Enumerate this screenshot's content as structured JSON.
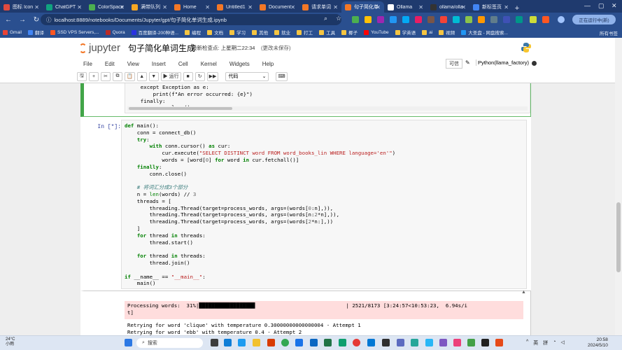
{
  "browser": {
    "tabs": [
      {
        "label": "图标 Icon",
        "color": "#e04a3f"
      },
      {
        "label": "ChatGPT",
        "color": "#10a37f"
      },
      {
        "label": "ColorSpace",
        "color": "#4caf50"
      },
      {
        "label": "满带队列",
        "color": "#f5a623"
      },
      {
        "label": "Home",
        "color": "#f37726"
      },
      {
        "label": "Untitled1",
        "color": "#f37726"
      },
      {
        "label": "Document",
        "color": "#f37726"
      },
      {
        "label": "请求单词",
        "color": "#f37726"
      },
      {
        "label": "句子简化单",
        "color": "#f37726",
        "active": true
      },
      {
        "label": "Ollama",
        "color": "#ffffff"
      },
      {
        "label": "ollama/olla",
        "color": "#333333"
      },
      {
        "label": "新标签页",
        "color": "#4285f4"
      }
    ],
    "new_tab": "+",
    "url": "localhost:8889/notebooks/Documents/Jupyter/gpt/句子简化单词生成.ipynb",
    "profile_label": "正在运行中(新)",
    "bookmarks": [
      {
        "label": "Gmail",
        "color": "#ea4335"
      },
      {
        "label": "翻译",
        "color": "#4285f4"
      },
      {
        "label": "SSD VPS Servers,...",
        "color": "#ff5722"
      },
      {
        "label": "Quora",
        "color": "#b92b27"
      },
      {
        "label": "百度翻译-200种语...",
        "color": "#2932e1"
      },
      {
        "label": "编程",
        "color": "#f5c542"
      },
      {
        "label": "文档",
        "color": "#f5c542"
      },
      {
        "label": "学习",
        "color": "#f5c542"
      },
      {
        "label": "其他",
        "color": "#f5c542"
      },
      {
        "label": "就业",
        "color": "#f5c542"
      },
      {
        "label": "打工",
        "color": "#f5c542"
      },
      {
        "label": "工具",
        "color": "#f5c542"
      },
      {
        "label": "椰子",
        "color": "#f5c542"
      },
      {
        "label": "YouTube",
        "color": "#ff0000"
      },
      {
        "label": "学英语",
        "color": "#f5c542"
      },
      {
        "label": "ai",
        "color": "#f5c542"
      },
      {
        "label": "视频",
        "color": "#f5c542"
      },
      {
        "label": "大圣盘 - 网盘搜索...",
        "color": "#2196f3"
      }
    ],
    "bookmarks_all": "所有书签"
  },
  "jupyter": {
    "logo": "jupyter",
    "notebook_title": "句子简化单词生成",
    "checkpoint": "最新检查点: 上星期二22:34",
    "unsaved": "(更改未保存)",
    "menu": [
      "File",
      "Edit",
      "View",
      "Insert",
      "Cell",
      "Kernel",
      "Widgets",
      "Help"
    ],
    "trusted": "可信",
    "kernel_name": "Python(llama_factory)",
    "toolbar": {
      "save": "🖫",
      "add": "+",
      "cut": "✂",
      "copy": "⧉",
      "paste": "📋",
      "up": "▲",
      "down": "▼",
      "run": "▶ 运行",
      "stop": "■",
      "restart": "↻",
      "fast_forward": "▶▶",
      "cell_type": "代码",
      "keyboard": "⌨"
    }
  },
  "cells": {
    "cell1_code": "    except Exception as e:\n        print(f\"An error occurred: {e}\")\n    finally:\n        conn.close()",
    "cell2_prompt": "In  [*]:",
    "cell2_lines": [
      "def main():",
      "    conn = connect_db()",
      "    try:",
      "        with conn.cursor() as cur:",
      "            cur.execute(\"SELECT DISTINCT word FROM word_books_lin WHERE language='en'\")",
      "            words = [word[0] for word in cur.fetchall()]",
      "    finally:",
      "        conn.close()",
      "",
      "    # 将词汇分成3个部分",
      "    n = len(words) // 3",
      "    threads = [",
      "        threading.Thread(target=process_words, args=(words[0:n],)),",
      "        threading.Thread(target=process_words, args=(words[n:2*n],)),",
      "        threading.Thread(target=process_words, args=(words[2*n:],))",
      "    ]",
      "    for thread in threads:",
      "        thread.start()",
      "",
      "    for thread in threads:",
      "        thread.join()",
      "",
      "if __name__ == \"__main__\":",
      "    main()"
    ],
    "stderr_line1_left": "Processing words:  31%|",
    "stderr_bar": "██████████████████",
    "stderr_line1_right": "| 2521/8173 [3:24:57<10:53:23,  6.94s/i",
    "stderr_line2": "t]",
    "stdout": "Retrying for word 'clique' with temperature 0.30000000000000004 - Attempt 1\nRetrying for word 'ebb' with temperature 0.4 - Attempt 2"
  },
  "taskbar": {
    "weather_temp": "24°C",
    "weather_desc": "小雨",
    "search_placeholder": "搜索",
    "tray_up": "^",
    "lang1": "英",
    "lang2": "拼",
    "time": "20:58",
    "date": "2024/5/10"
  }
}
